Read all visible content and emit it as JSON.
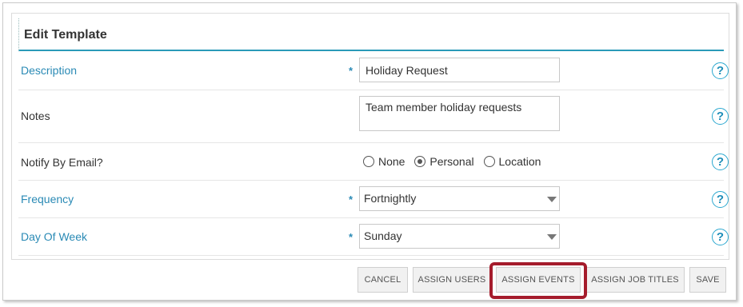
{
  "panel": {
    "title": "Edit Template"
  },
  "rows": {
    "description": {
      "label": "Description",
      "required": "*",
      "value": "Holiday Request"
    },
    "notes": {
      "label": "Notes",
      "value": "Team member holiday requests"
    },
    "notify": {
      "label": "Notify By Email?",
      "options": [
        "None",
        "Personal",
        "Location"
      ],
      "selected": "Personal"
    },
    "frequency": {
      "label": "Frequency",
      "required": "*",
      "value": "Fortnightly"
    },
    "day_of_week": {
      "label": "Day Of Week",
      "required": "*",
      "value": "Sunday"
    }
  },
  "help_glyph": "?",
  "buttons": {
    "cancel": "CANCEL",
    "assign_users": "ASSIGN USERS",
    "assign_events": "ASSIGN EVENTS",
    "assign_job_titles": "ASSIGN JOB TITLES",
    "save": "SAVE"
  },
  "colors": {
    "required_label": "#2a8ab5",
    "title_underline": "#2a9ab8",
    "highlight_box": "#a51c2c"
  }
}
